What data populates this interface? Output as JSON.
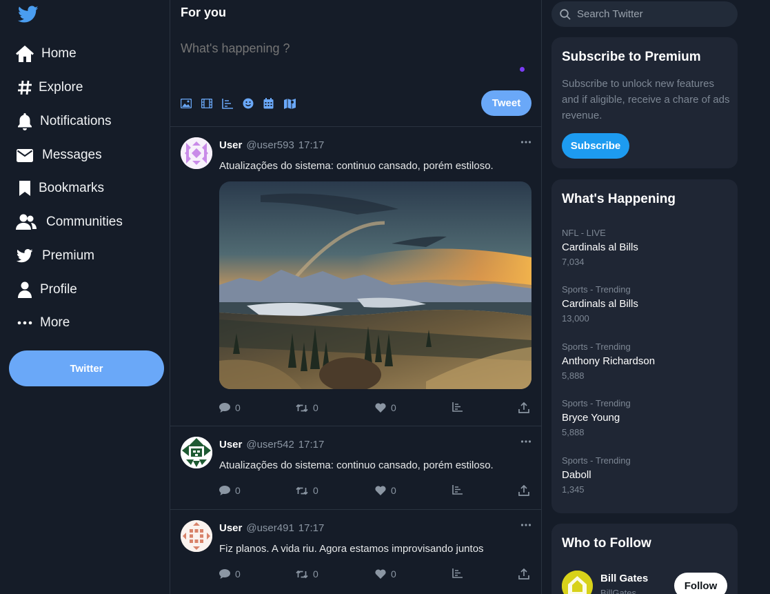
{
  "brand": {
    "logo_icon": "twitter-bird-icon",
    "accent": "#6aa8f8",
    "subscribe_color": "#1d9bf0"
  },
  "sidebar": {
    "items": [
      {
        "label": "Home",
        "icon": "home-icon"
      },
      {
        "label": "Explore",
        "icon": "hashtag-icon"
      },
      {
        "label": "Notifications",
        "icon": "bell-icon"
      },
      {
        "label": "Messages",
        "icon": "envelope-icon"
      },
      {
        "label": "Bookmarks",
        "icon": "bookmark-icon"
      },
      {
        "label": "Communities",
        "icon": "users-icon"
      },
      {
        "label": "Premium",
        "icon": "twitter-bird-icon"
      },
      {
        "label": "Profile",
        "icon": "user-icon"
      },
      {
        "label": "More",
        "icon": "ellipsis-icon"
      }
    ],
    "button_label": "Twitter"
  },
  "main": {
    "title": "For you",
    "compose": {
      "placeholder": "What's happening ?",
      "tweet_label": "Tweet",
      "icons": [
        "image-icon",
        "film-icon",
        "poll-icon",
        "emoji-icon",
        "calendar-icon",
        "map-icon"
      ]
    },
    "tweets": [
      {
        "name": "User",
        "handle": "@user593",
        "time": "17:17",
        "text": "Atualizações do sistema: continuo cansado, porém estiloso.",
        "has_image": true,
        "replies": "0",
        "retweets": "0",
        "likes": "0"
      },
      {
        "name": "User",
        "handle": "@user542",
        "time": "17:17",
        "text": "Atualizações do sistema: continuo cansado, porém estiloso.",
        "has_image": false,
        "replies": "0",
        "retweets": "0",
        "likes": "0"
      },
      {
        "name": "User",
        "handle": "@user491",
        "time": "17:17",
        "text": "Fiz planos. A vida riu. Agora estamos improvisando juntos",
        "has_image": false,
        "replies": "0",
        "retweets": "0",
        "likes": "0"
      }
    ]
  },
  "right": {
    "search_placeholder": "Search Twitter",
    "premium": {
      "title": "Subscribe to Premium",
      "text": "Subscribe to unlock new features and if aligible, receive a chare of ads revenue.",
      "button_label": "Subscribe"
    },
    "happening": {
      "title": "What's Happening",
      "trends": [
        {
          "category": "NFL - LIVE",
          "name": "Cardinals al Bills",
          "count": "7,034"
        },
        {
          "category": "Sports - Trending",
          "name": "Cardinals al Bills",
          "count": "13,000"
        },
        {
          "category": "Sports - Trending",
          "name": "Anthony Richardson",
          "count": "5,888"
        },
        {
          "category": "Sports - Trending",
          "name": "Bryce Young",
          "count": "5,888"
        },
        {
          "category": "Sports - Trending",
          "name": "Daboll",
          "count": "1,345"
        }
      ]
    },
    "follow": {
      "title": "Who to Follow",
      "name": "Bill Gates",
      "handle": "BillGates",
      "button_label": "Follow"
    }
  }
}
